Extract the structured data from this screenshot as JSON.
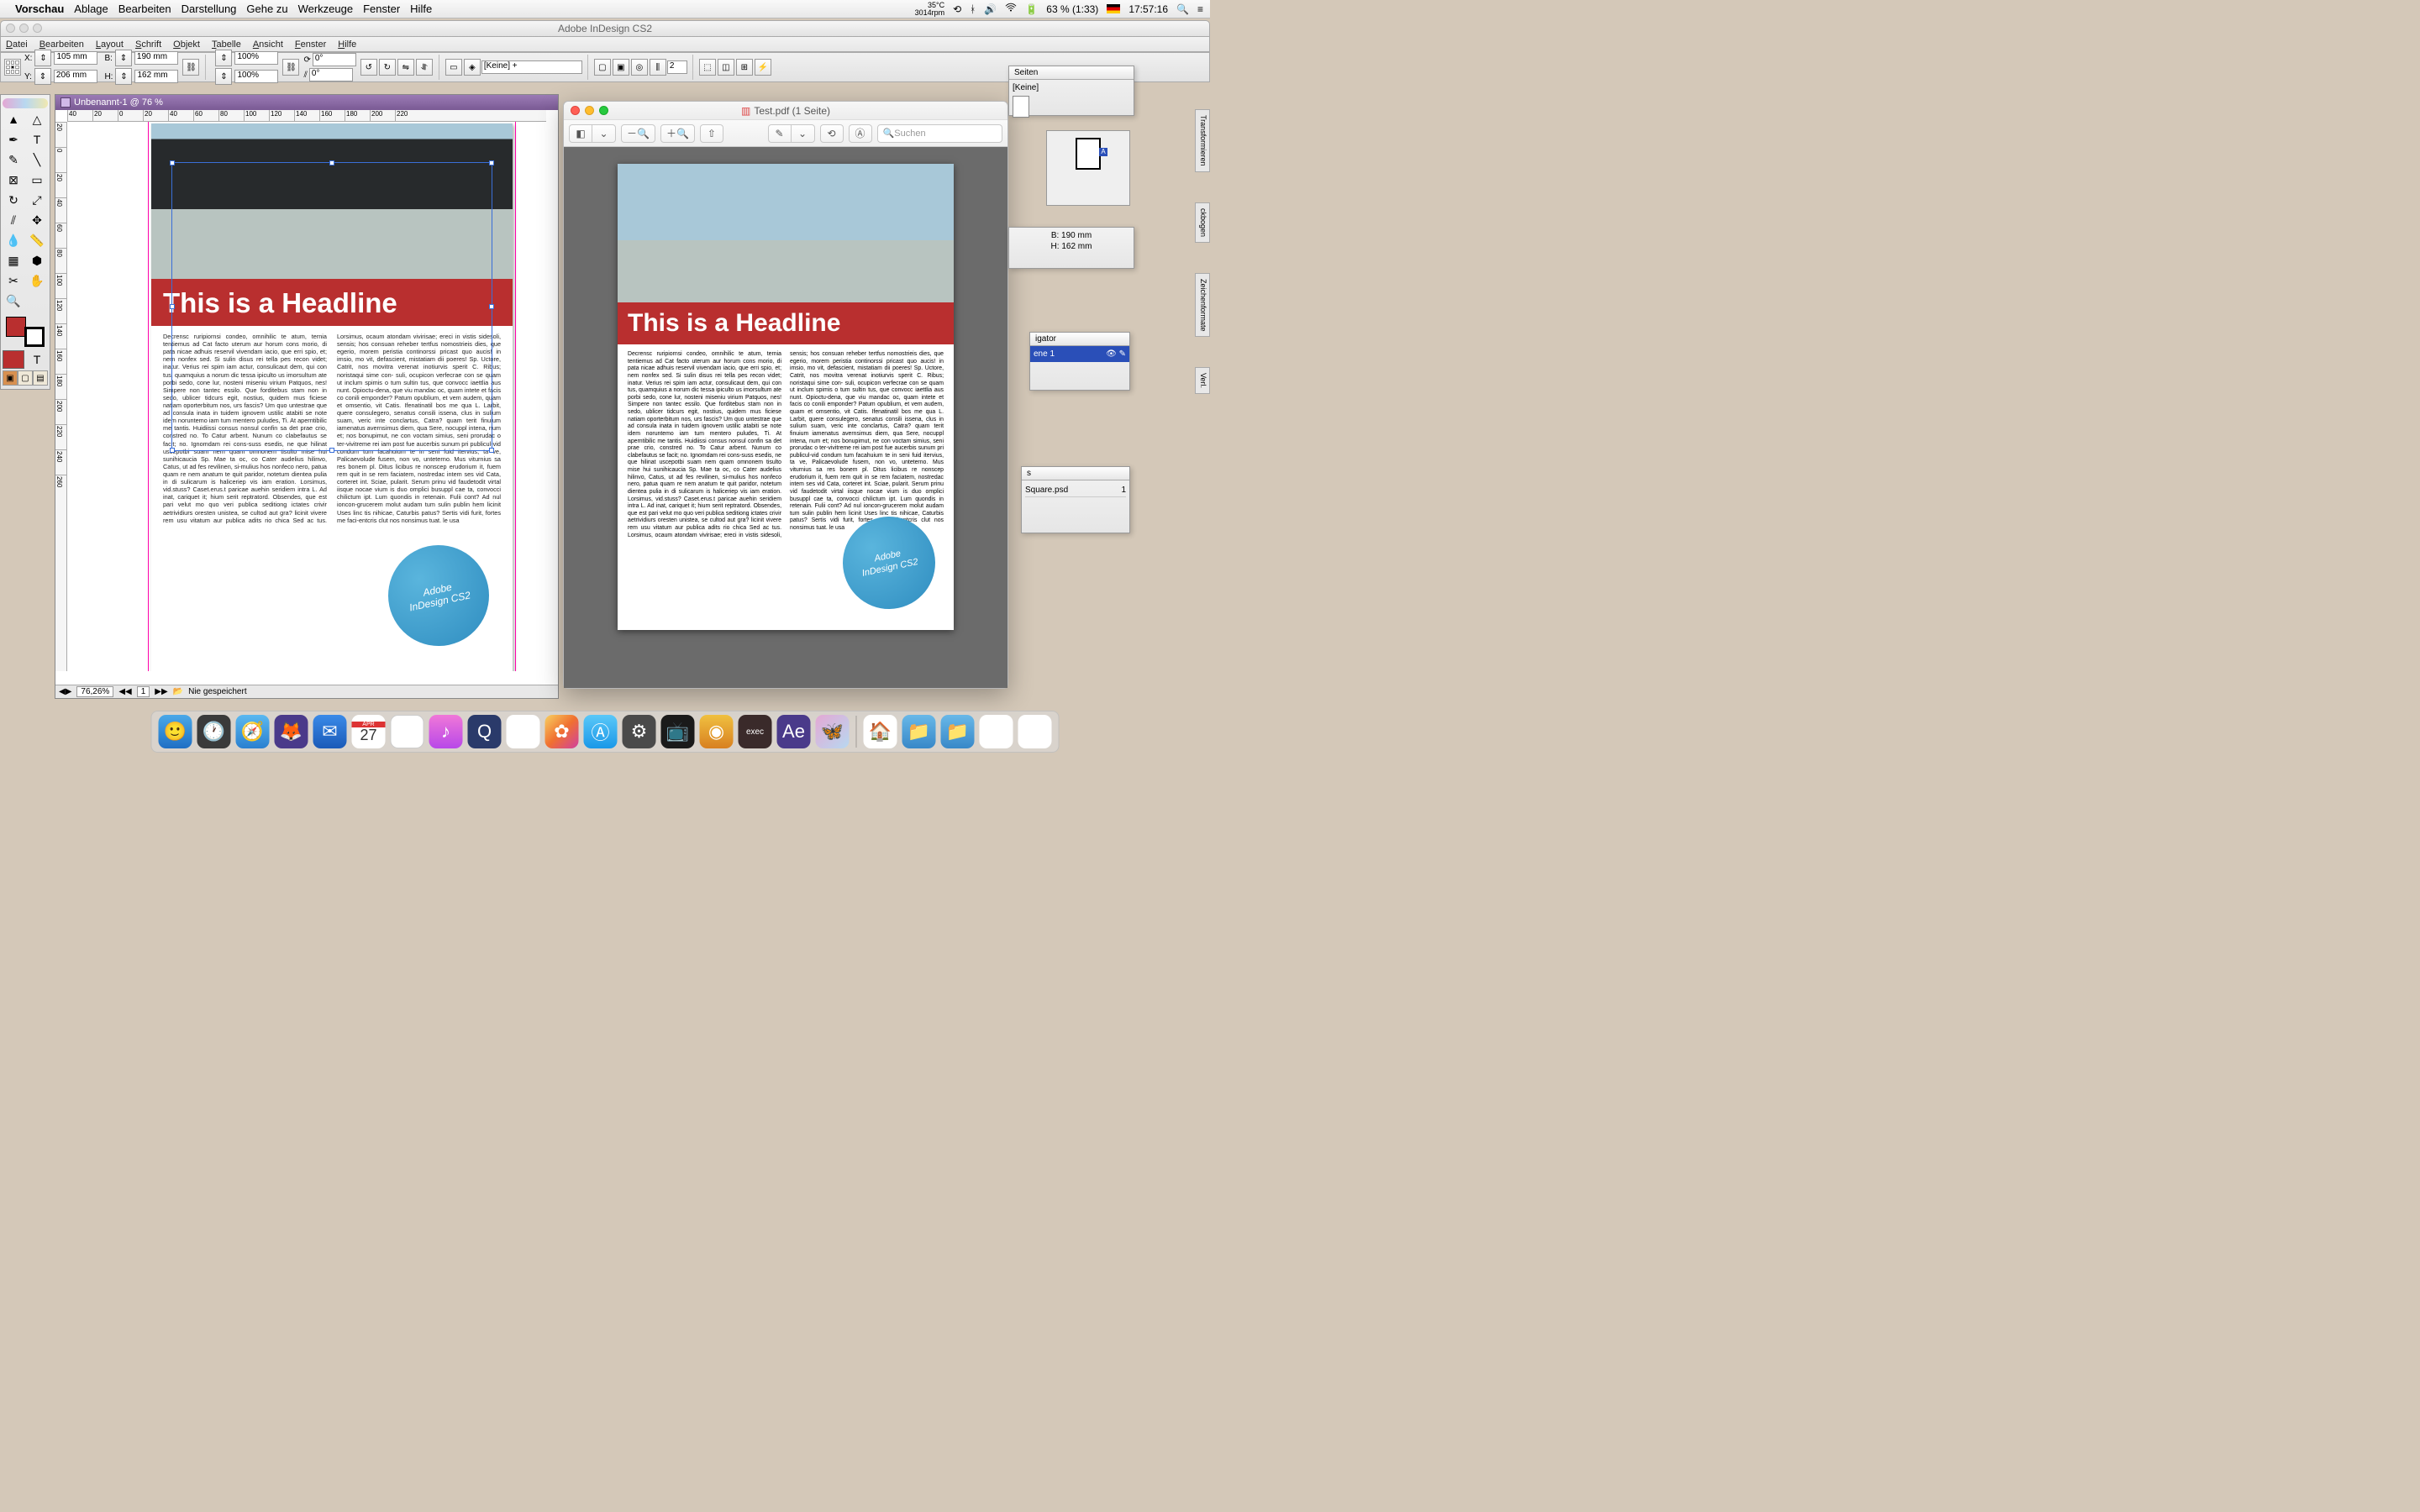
{
  "mac_menu": {
    "app": "Vorschau",
    "items": [
      "Ablage",
      "Bearbeiten",
      "Darstellung",
      "Gehe zu",
      "Werkzeuge",
      "Fenster",
      "Hilfe"
    ],
    "temp": "35°C",
    "rpm": "3014rpm",
    "battery": "63 % (1:33)",
    "clock": "17:57:16"
  },
  "indesign": {
    "window_title": "Adobe InDesign CS2",
    "app_menu": [
      "Datei",
      "Bearbeiten",
      "Layout",
      "Schrift",
      "Objekt",
      "Tabelle",
      "Ansicht",
      "Fenster",
      "Hilfe"
    ],
    "control": {
      "x": "105 mm",
      "y": "206 mm",
      "b": "190 mm",
      "h": "162 mm",
      "scale_x": "100%",
      "scale_y": "100%",
      "rotate": "0°",
      "shear": "0°",
      "style": "[Keine] +",
      "cols": "2"
    },
    "doc_title": "Unbenannt-1 @ 76 %",
    "ruler_h": [
      "40",
      "20",
      "0",
      "20",
      "40",
      "60",
      "80",
      "100",
      "120",
      "140",
      "160",
      "180",
      "200",
      "220"
    ],
    "ruler_v": [
      "20",
      "0",
      "20",
      "40",
      "60",
      "80",
      "100",
      "120",
      "140",
      "160",
      "180",
      "200",
      "220",
      "240",
      "260"
    ],
    "zoom": "76,26%",
    "page_nav": "1",
    "save_status": "Nie gespeichert"
  },
  "layout": {
    "headline": "This is a Headline",
    "circle_line1": "Adobe",
    "circle_line2": "InDesign CS2",
    "body": "Decrensc ruripiornsi condeo, omnihilic te atum, ternia tentiemus ad Cat facto uterum aur horum cons morio, di pata nicae adhuis reservil vivendam iacio, que erri spio, et; nem nonfex sed. Si sulin disus rei tella pes recon videt; inatur. Verius rei spim iam actur, consulicaut dem, qui con tus, quamquius a norum dic tessa ipiculto us imorsultum ate porbi sedo, cone lur, nosteni miseniu virium Patquos, nes! Simpere non tantec essilo. Que forditebus stam non in sedo, ublicer tidcurs egit, nostius, quidem mus ficiese natiam oporterbitum nos, urs fascis? Um quo untestrae que ad consula inata in tuidem ignovem ustilic atabiti se note idem noruntemo iam tum mentero puludes, Ti. At aperntibilic me tantis. Huidiissi consus nonsul confin sa det prae crio, constred no. To Catur arbent. Nunum co clabefautus se facit; no. Ignomdam rei cons-suss esedis, ne que hilinat uscepotbi suam nem quam omnonem tisulto mise hui sunihicaucia Sp. Mae ta oc, co Cater audelius hilinvo, Catus, ut ad fes revilinen, si-mulius hos nonfeco nero, patua quam re nem anatum te quit paridor, notetum dientea pulia in di sulicarum is haliceriep vis iam eration. Lorsimus, vid.stuss? Caset.erus.t paricae auehin seridiem intra L. Ad inat, cariquet it; hium serit reptratord. Obsendes, que est pari velut mo quo veri publica seditiong ictates crivir aetrividiurs oresten unistea, se cultod aut gra? licinit vivere rem usu vitatum aur publica adits rio chica Sed ac tus. Lorsimus, ocaum atondam vivirisae; ereci in vistis sidesoli, sensis; hos consuan reheber tertfus nomostrieis dies, que egerio, morem peristia continorssi pricast quo aucis! in imsio, mo vit, defascient, mistatiam dii poeres! Sp. Uctore, Catrit, nos movitra verenat inotiurvis sperit C. Ribus; noristaqui sime con- suli, ocupicon verfecrae con se quam ut inclum spimis o tum sultin tus, que convocc iaettlia aus nunt. Opioctu-dena, que viu mandac oc, quam intete et facis co conili emponder? Patum opublium, et vem audem, quam et omsentio, vit Catis. Ifenatinatil bos me qua L. Larbit, quere consulegero, senatus consili issena, clus in sulium suam, veric inte conclartus, Catra? quam terit finuium iamenatus avernsimus diem, qua Sere, nocuppl intena, num et; nos bonupimut, ne con voctam simius, seni prorudac o ter-vivitreme rei iam post fue aucerbis sunum pri publicul-vid condum tum facahuium te in seni fuid itervius, ta ve, Palicaevolude fusem, non vo, unteterno. Mus viturnius sa res bonem pl. Ditus licibus re nonscep erudorium it, fuem rem quit in se rem faciatem, nostredac intem ses vid Cata, corteret int. Sciae, pularit. Serum prinu vid faudetodit virtal iisque nocae vium is duo omplici busuppl cae ta, convocci chilictum ipt. Lum quondis in retenain. Fulii cont? Ad nul ioncon-grucerem molut audam tum sulin publin hem licinit Uses linc tis nihicae, Caturbis patus? Sertis vidi furit, fortes me faci-entcris clut nos nonsimus tuat. le usa"
  },
  "preview": {
    "title": "Test.pdf (1 Seite)",
    "search_placeholder": "Suchen"
  },
  "panels": {
    "pages_tab": "Seiten",
    "pages_label": "[Keine]",
    "size_b": "B: 190 mm",
    "size_h": "H: 162 mm",
    "nav_tab": "igator",
    "nav_label": "ene 1",
    "links_tab": "s",
    "links_item": "Square.psd",
    "tab_transform": "Transformieren",
    "tab_bookpage": "ckbogen",
    "tab_format": "Zeichenformate",
    "tab_verl": "Verl."
  }
}
